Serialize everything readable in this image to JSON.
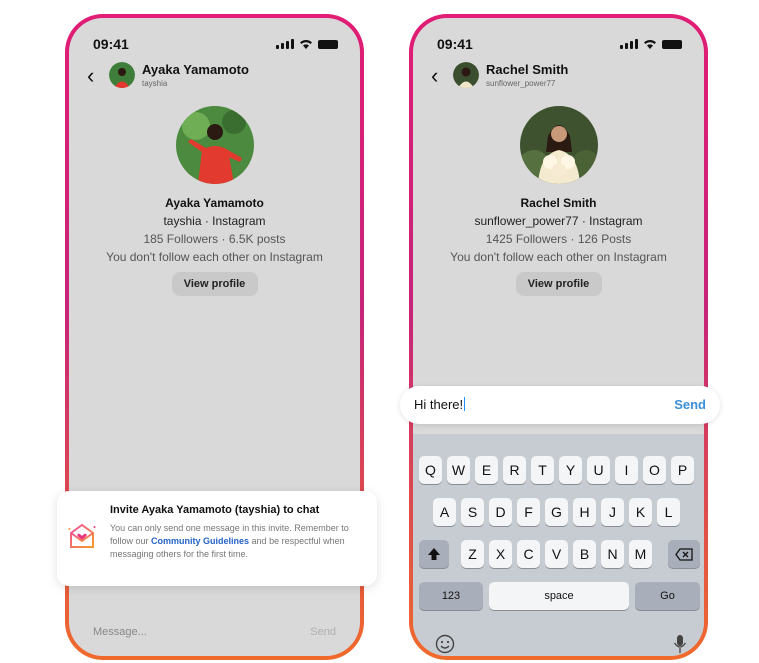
{
  "phone1": {
    "status_time": "09:41",
    "header": {
      "name": "Ayaka Yamamoto",
      "sub": "tayshia"
    },
    "profile": {
      "name": "Ayaka Yamamoto",
      "handle": "tayshia · Instagram",
      "stats": "185 Followers · 6.5K posts",
      "note": "You don't follow each other on Instagram",
      "view_profile": "View profile"
    },
    "invite": {
      "title": "Invite Ayaka Yamamoto (tayshia) to chat",
      "body_before": "You can only send one message in this invite. Remember to follow our ",
      "link": "Community Guidelines",
      "body_after": " and be respectful when messaging others for the first time."
    },
    "message_bar": {
      "placeholder": "Message...",
      "send": "Send"
    }
  },
  "phone2": {
    "status_time": "09:41",
    "header": {
      "name": "Rachel Smith",
      "sub": "sunflower_power77"
    },
    "profile": {
      "name": "Rachel Smith",
      "handle": "sunflower_power77 · Instagram",
      "stats": "1425 Followers · 126 Posts",
      "note": "You don't follow each other on Instagram",
      "view_profile": "View profile"
    },
    "input": {
      "value": "Hi there!",
      "send": "Send"
    },
    "keyboard": {
      "row1": [
        "Q",
        "W",
        "E",
        "R",
        "T",
        "Y",
        "U",
        "I",
        "O",
        "P"
      ],
      "row2": [
        "A",
        "S",
        "D",
        "F",
        "G",
        "H",
        "J",
        "K",
        "L"
      ],
      "row3": [
        "Z",
        "X",
        "C",
        "V",
        "B",
        "N",
        "M"
      ],
      "numbers": "123",
      "space": "space",
      "go": "Go"
    }
  },
  "colors": {
    "gradient_top": "#e11d74",
    "gradient_bottom": "#f06a2b",
    "link": "#2563c9",
    "send_active": "#3a8fd8"
  }
}
